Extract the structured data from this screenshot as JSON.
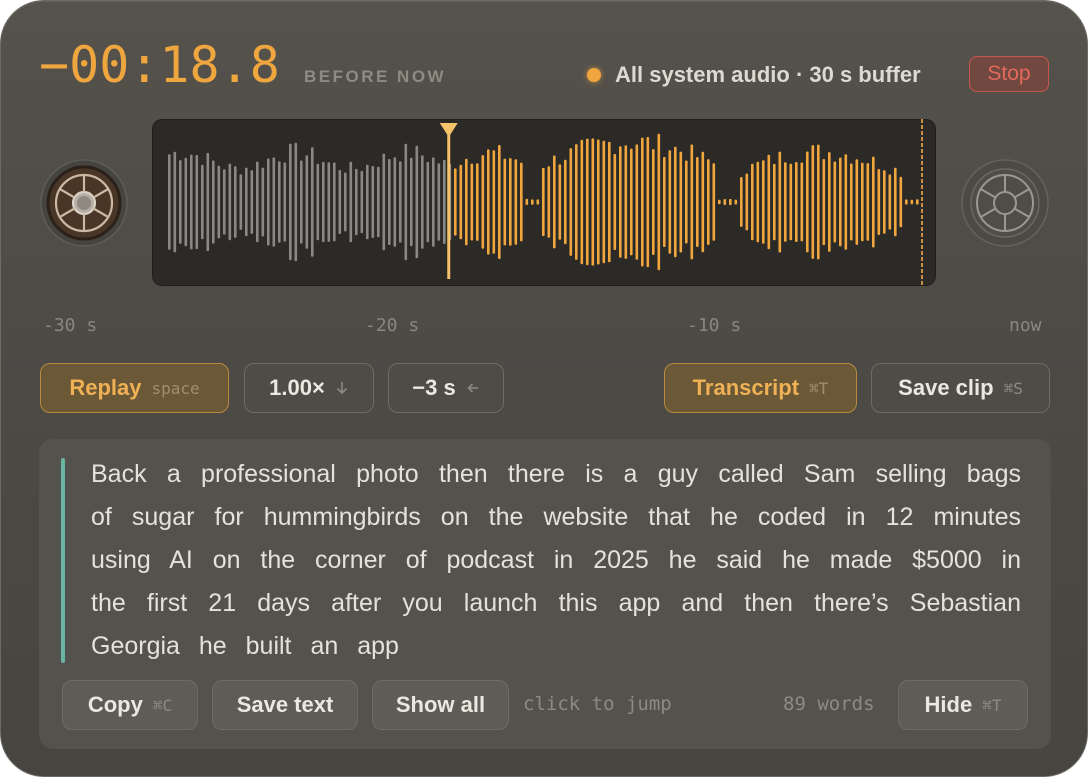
{
  "timer": {
    "value": "−00:18.8",
    "caption": "BEFORE NOW"
  },
  "status": {
    "text": "All system audio · 30 s buffer",
    "stop_label": "Stop",
    "dot_color": "#f0a63f"
  },
  "colors": {
    "accent": "#f0a63f",
    "played": "#8a8884",
    "stop": "#e26a5c",
    "quote_bar": "#69b5a4"
  },
  "playback": {
    "playhead_seconds_before_now": 18.8,
    "buffer_seconds": 30
  },
  "timeline": {
    "labels": [
      "-30 s",
      "-20 s",
      "-10 s",
      "now"
    ]
  },
  "controls": {
    "replay": {
      "label": "Replay",
      "shortcut": "space"
    },
    "speed": {
      "label": "1.00×",
      "icon": "arrow-down-icon"
    },
    "skip": {
      "label": "−3 s",
      "icon": "arrow-left-icon"
    },
    "transcript": {
      "label": "Transcript",
      "shortcut": "⌘T"
    },
    "save_clip": {
      "label": "Save clip",
      "shortcut": "⌘S"
    }
  },
  "transcript": {
    "text": "Back a professional photo then there is a guy called Sam selling bags of sugar for hummingbirds on the website that he coded in 12 minutes using AI on the corner of podcast in 2025 he said he made $5000 in the first 21 days after you launch this app and then there’s Sebastian Georgia he built an app",
    "copy": {
      "label": "Copy",
      "shortcut": "⌘C"
    },
    "save_text": "Save text",
    "show_all": "Show all",
    "hint": "click to jump",
    "word_count": "89 words",
    "hide": {
      "label": "Hide",
      "shortcut": "⌘T"
    }
  }
}
